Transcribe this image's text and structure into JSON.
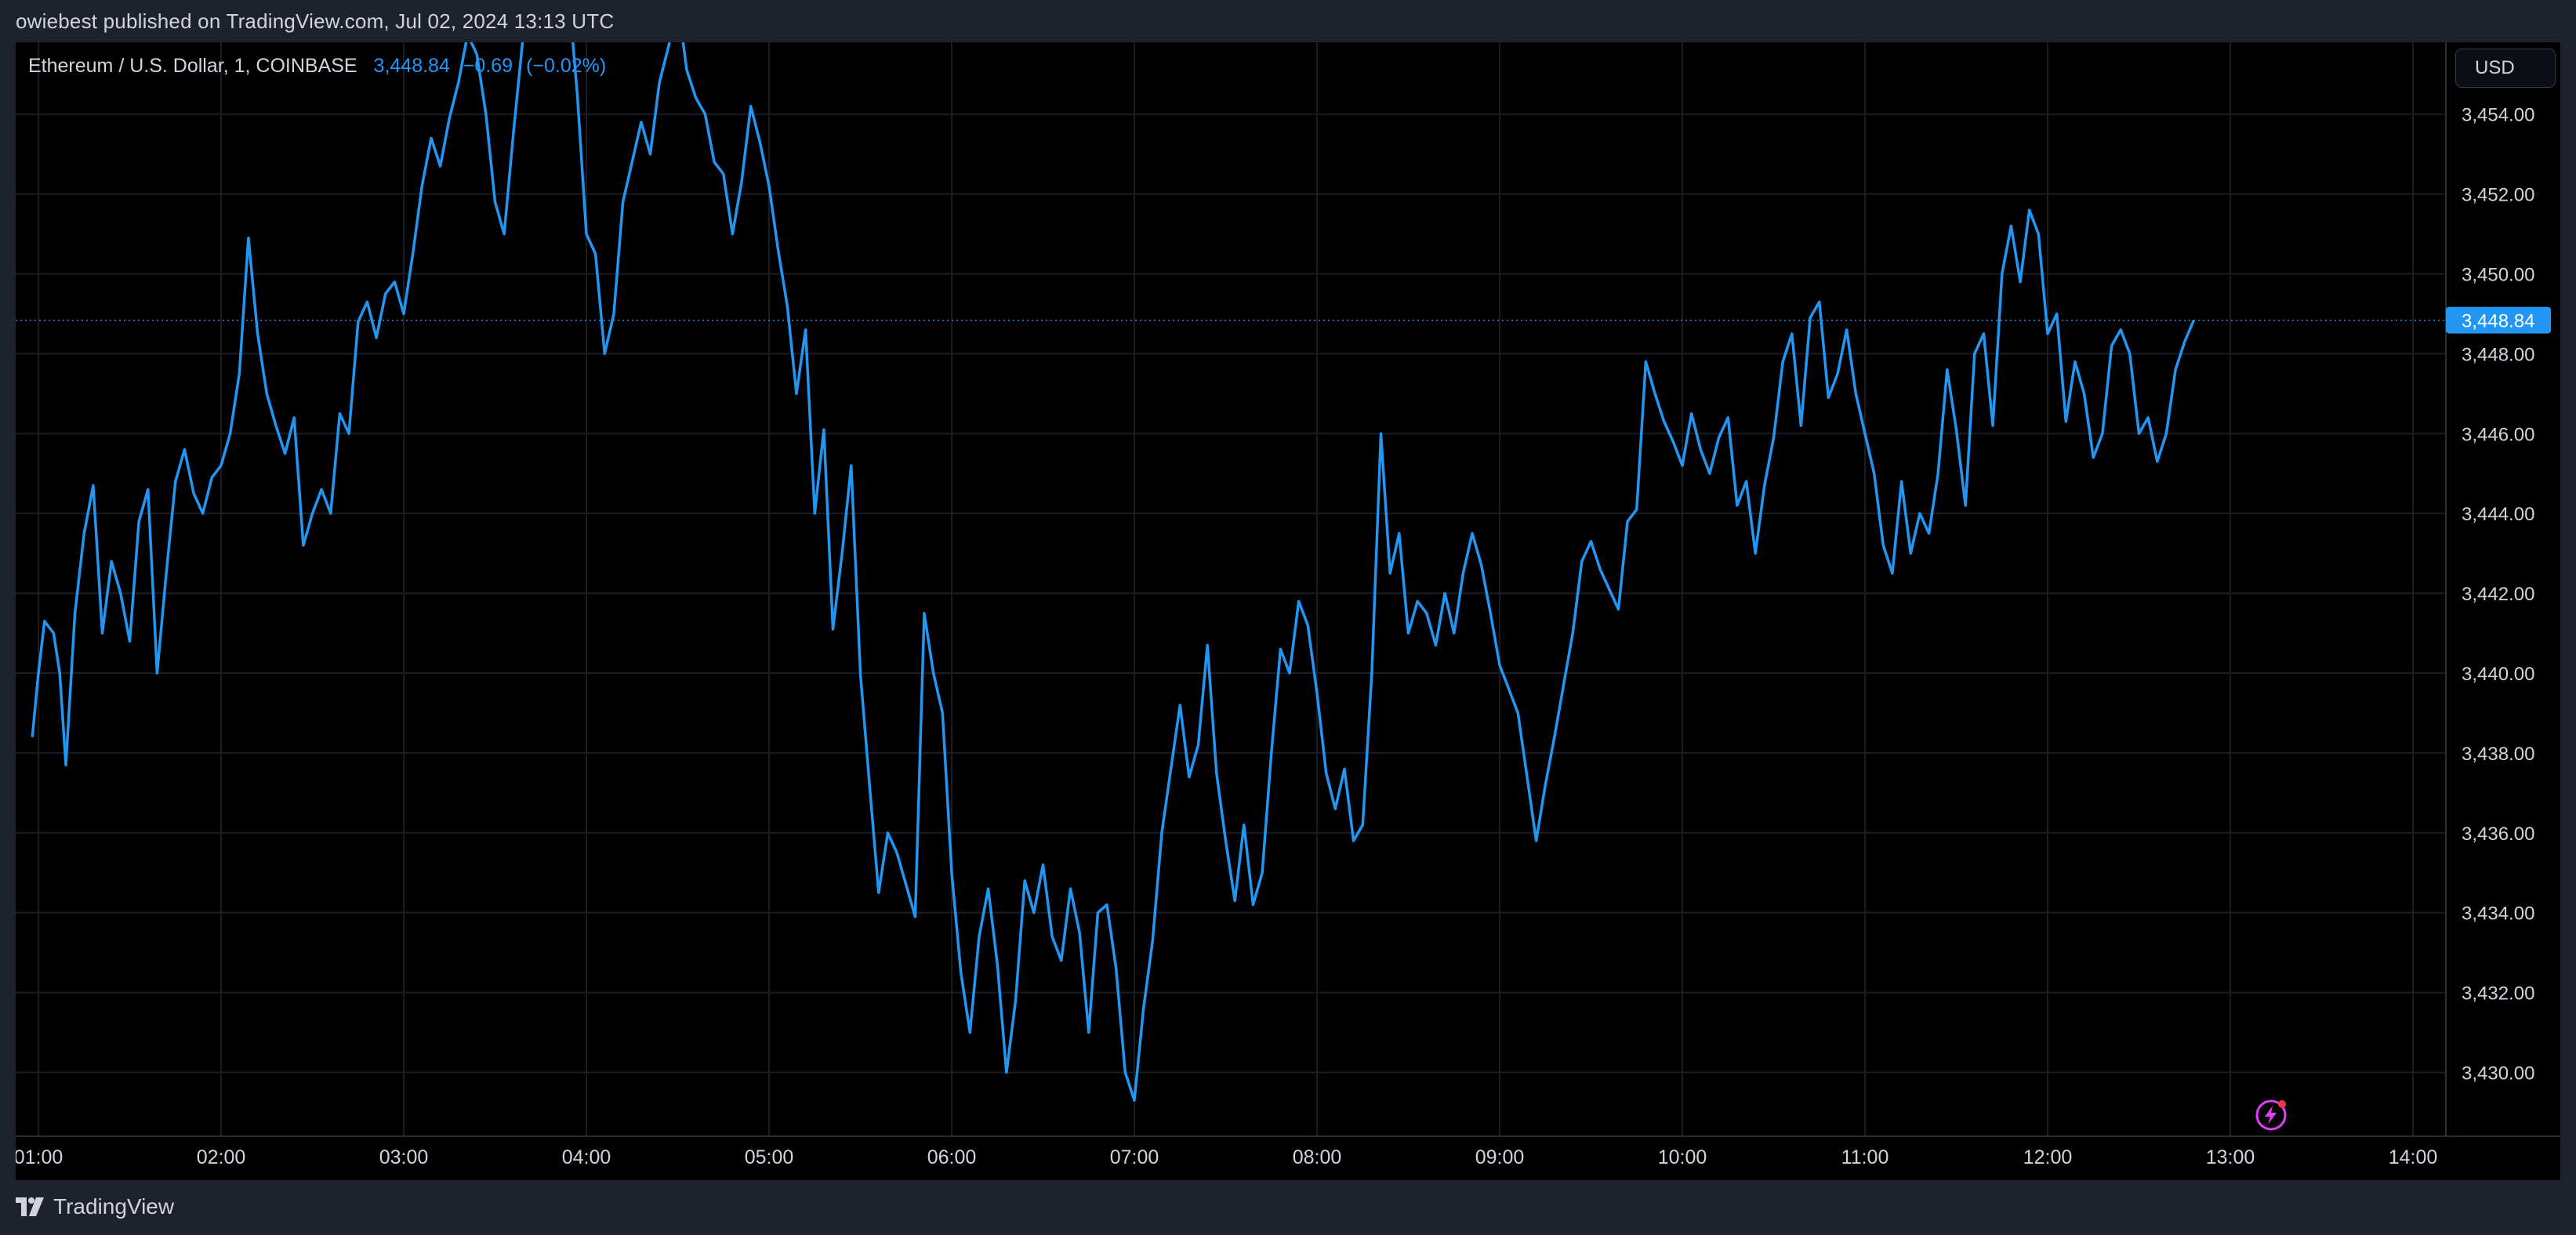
{
  "header": {
    "publish_text": "owiebest published on TradingView.com, Jul 02, 2024 13:13 UTC"
  },
  "legend": {
    "symbol": "Ethereum / U.S. Dollar, 1, COINBASE",
    "last": "3,448.84",
    "change": "−0.69",
    "change_pct": "(−0.02%)"
  },
  "currency_button": "USD",
  "footer": {
    "brand": "TradingView"
  },
  "icons": [
    "tradingview-logo-icon",
    "lightning-icon"
  ],
  "colors": {
    "line": "#2196f3",
    "background": "#000000",
    "frame": "#1e222d",
    "text": "#d1d4dc",
    "bolt_accent": "#e040fb",
    "bolt_dot": "#f23645"
  },
  "chart_data": {
    "type": "line",
    "title": "Ethereum / U.S. Dollar, 1, COINBASE",
    "series": [
      {
        "values": [
          [
            "00:58",
            3438.4
          ],
          [
            "01:00",
            3440.0
          ],
          [
            "01:02",
            3441.3
          ],
          [
            "01:05",
            3441.0
          ],
          [
            "01:07",
            3440.0
          ],
          [
            "01:09",
            3437.7
          ],
          [
            "01:12",
            3441.5
          ],
          [
            "01:15",
            3443.5
          ],
          [
            "01:18",
            3444.7
          ],
          [
            "01:21",
            3441.0
          ],
          [
            "01:24",
            3442.8
          ],
          [
            "01:27",
            3442.0
          ],
          [
            "01:30",
            3440.8
          ],
          [
            "01:33",
            3443.8
          ],
          [
            "01:36",
            3444.6
          ],
          [
            "01:39",
            3440.0
          ],
          [
            "01:42",
            3442.5
          ],
          [
            "01:45",
            3444.8
          ],
          [
            "01:48",
            3445.6
          ],
          [
            "01:51",
            3444.5
          ],
          [
            "01:54",
            3444.0
          ],
          [
            "01:57",
            3444.9
          ],
          [
            "02:00",
            3445.2
          ],
          [
            "02:03",
            3446.0
          ],
          [
            "02:06",
            3447.5
          ],
          [
            "02:09",
            3450.9
          ],
          [
            "02:12",
            3448.5
          ],
          [
            "02:15",
            3447.0
          ],
          [
            "02:18",
            3446.2
          ],
          [
            "02:21",
            3445.5
          ],
          [
            "02:24",
            3446.4
          ],
          [
            "02:27",
            3443.2
          ],
          [
            "02:30",
            3444.0
          ],
          [
            "02:33",
            3444.6
          ],
          [
            "02:36",
            3444.0
          ],
          [
            "02:39",
            3446.5
          ],
          [
            "02:42",
            3446.0
          ],
          [
            "02:45",
            3448.8
          ],
          [
            "02:48",
            3449.3
          ],
          [
            "02:51",
            3448.4
          ],
          [
            "02:54",
            3449.5
          ],
          [
            "02:57",
            3449.8
          ],
          [
            "03:00",
            3449.0
          ],
          [
            "03:03",
            3450.5
          ],
          [
            "03:06",
            3452.2
          ],
          [
            "03:09",
            3453.4
          ],
          [
            "03:12",
            3452.7
          ],
          [
            "03:15",
            3453.9
          ],
          [
            "03:18",
            3454.8
          ],
          [
            "03:21",
            3456.0
          ],
          [
            "03:24",
            3455.5
          ],
          [
            "03:27",
            3454.0
          ],
          [
            "03:30",
            3451.8
          ],
          [
            "03:33",
            3451.0
          ],
          [
            "03:36",
            3453.5
          ],
          [
            "03:39",
            3455.8
          ],
          [
            "03:42",
            3456.5
          ],
          [
            "03:45",
            3457.0
          ],
          [
            "03:48",
            3456.0
          ],
          [
            "03:51",
            3456.6
          ],
          [
            "03:54",
            3457.2
          ],
          [
            "03:57",
            3454.5
          ],
          [
            "04:00",
            3451.0
          ],
          [
            "04:03",
            3450.5
          ],
          [
            "04:06",
            3448.0
          ],
          [
            "04:09",
            3449.0
          ],
          [
            "04:12",
            3451.8
          ],
          [
            "04:15",
            3452.8
          ],
          [
            "04:18",
            3453.8
          ],
          [
            "04:21",
            3453.0
          ],
          [
            "04:24",
            3454.8
          ],
          [
            "04:27",
            3455.7
          ],
          [
            "04:30",
            3456.8
          ],
          [
            "04:33",
            3455.1
          ],
          [
            "04:36",
            3454.4
          ],
          [
            "04:39",
            3454.0
          ],
          [
            "04:42",
            3452.8
          ],
          [
            "04:45",
            3452.5
          ],
          [
            "04:48",
            3451.0
          ],
          [
            "04:51",
            3452.3
          ],
          [
            "04:54",
            3454.2
          ],
          [
            "04:57",
            3453.3
          ],
          [
            "05:00",
            3452.2
          ],
          [
            "05:03",
            3450.6
          ],
          [
            "05:06",
            3449.2
          ],
          [
            "05:09",
            3447.0
          ],
          [
            "05:12",
            3448.6
          ],
          [
            "05:15",
            3444.0
          ],
          [
            "05:18",
            3446.1
          ],
          [
            "05:21",
            3441.1
          ],
          [
            "05:24",
            3443.0
          ],
          [
            "05:27",
            3445.2
          ],
          [
            "05:30",
            3440.0
          ],
          [
            "05:33",
            3437.2
          ],
          [
            "05:36",
            3434.5
          ],
          [
            "05:39",
            3436.0
          ],
          [
            "05:42",
            3435.5
          ],
          [
            "05:45",
            3434.7
          ],
          [
            "05:48",
            3433.9
          ],
          [
            "05:51",
            3441.5
          ],
          [
            "05:54",
            3440.0
          ],
          [
            "05:57",
            3439.0
          ],
          [
            "06:00",
            3435.0
          ],
          [
            "06:03",
            3432.5
          ],
          [
            "06:06",
            3431.0
          ],
          [
            "06:09",
            3433.4
          ],
          [
            "06:12",
            3434.6
          ],
          [
            "06:15",
            3432.7
          ],
          [
            "06:18",
            3430.0
          ],
          [
            "06:21",
            3431.8
          ],
          [
            "06:24",
            3434.8
          ],
          [
            "06:27",
            3434.0
          ],
          [
            "06:30",
            3435.2
          ],
          [
            "06:33",
            3433.4
          ],
          [
            "06:36",
            3432.8
          ],
          [
            "06:39",
            3434.6
          ],
          [
            "06:42",
            3433.5
          ],
          [
            "06:45",
            3431.0
          ],
          [
            "06:48",
            3434.0
          ],
          [
            "06:51",
            3434.2
          ],
          [
            "06:54",
            3432.6
          ],
          [
            "06:57",
            3430.0
          ],
          [
            "07:00",
            3429.3
          ],
          [
            "07:03",
            3431.6
          ],
          [
            "07:06",
            3433.3
          ],
          [
            "07:09",
            3436.0
          ],
          [
            "07:12",
            3437.6
          ],
          [
            "07:15",
            3439.2
          ],
          [
            "07:18",
            3437.4
          ],
          [
            "07:21",
            3438.2
          ],
          [
            "07:24",
            3440.7
          ],
          [
            "07:27",
            3437.5
          ],
          [
            "07:30",
            3435.8
          ],
          [
            "07:33",
            3434.3
          ],
          [
            "07:36",
            3436.2
          ],
          [
            "07:39",
            3434.2
          ],
          [
            "07:42",
            3435.0
          ],
          [
            "07:45",
            3438.0
          ],
          [
            "07:48",
            3440.6
          ],
          [
            "07:51",
            3440.0
          ],
          [
            "07:54",
            3441.8
          ],
          [
            "07:57",
            3441.2
          ],
          [
            "08:00",
            3439.5
          ],
          [
            "08:03",
            3437.5
          ],
          [
            "08:06",
            3436.6
          ],
          [
            "08:09",
            3437.6
          ],
          [
            "08:12",
            3435.8
          ],
          [
            "08:15",
            3436.2
          ],
          [
            "08:18",
            3440.0
          ],
          [
            "08:21",
            3446.0
          ],
          [
            "08:24",
            3442.5
          ],
          [
            "08:27",
            3443.5
          ],
          [
            "08:30",
            3441.0
          ],
          [
            "08:33",
            3441.8
          ],
          [
            "08:36",
            3441.5
          ],
          [
            "08:39",
            3440.7
          ],
          [
            "08:42",
            3442.0
          ],
          [
            "08:45",
            3441.0
          ],
          [
            "08:48",
            3442.5
          ],
          [
            "08:51",
            3443.5
          ],
          [
            "08:54",
            3442.7
          ],
          [
            "08:57",
            3441.5
          ],
          [
            "09:00",
            3440.2
          ],
          [
            "09:03",
            3439.6
          ],
          [
            "09:06",
            3439.0
          ],
          [
            "09:09",
            3437.4
          ],
          [
            "09:12",
            3435.8
          ],
          [
            "09:15",
            3437.2
          ],
          [
            "09:18",
            3438.4
          ],
          [
            "09:21",
            3439.7
          ],
          [
            "09:24",
            3441.0
          ],
          [
            "09:27",
            3442.8
          ],
          [
            "09:30",
            3443.3
          ],
          [
            "09:33",
            3442.6
          ],
          [
            "09:36",
            3442.1
          ],
          [
            "09:39",
            3441.6
          ],
          [
            "09:42",
            3443.8
          ],
          [
            "09:45",
            3444.1
          ],
          [
            "09:48",
            3447.8
          ],
          [
            "09:51",
            3447.0
          ],
          [
            "09:54",
            3446.3
          ],
          [
            "09:57",
            3445.8
          ],
          [
            "10:00",
            3445.2
          ],
          [
            "10:03",
            3446.5
          ],
          [
            "10:06",
            3445.6
          ],
          [
            "10:09",
            3445.0
          ],
          [
            "10:12",
            3445.9
          ],
          [
            "10:15",
            3446.4
          ],
          [
            "10:18",
            3444.2
          ],
          [
            "10:21",
            3444.8
          ],
          [
            "10:24",
            3443.0
          ],
          [
            "10:27",
            3444.7
          ],
          [
            "10:30",
            3445.9
          ],
          [
            "10:33",
            3447.8
          ],
          [
            "10:36",
            3448.5
          ],
          [
            "10:39",
            3446.2
          ],
          [
            "10:42",
            3448.9
          ],
          [
            "10:45",
            3449.3
          ],
          [
            "10:48",
            3446.9
          ],
          [
            "10:51",
            3447.5
          ],
          [
            "10:54",
            3448.6
          ],
          [
            "10:57",
            3447.0
          ],
          [
            "11:00",
            3446.0
          ],
          [
            "11:03",
            3445.0
          ],
          [
            "11:06",
            3443.2
          ],
          [
            "11:09",
            3442.5
          ],
          [
            "11:12",
            3444.8
          ],
          [
            "11:15",
            3443.0
          ],
          [
            "11:18",
            3444.0
          ],
          [
            "11:21",
            3443.5
          ],
          [
            "11:24",
            3445.0
          ],
          [
            "11:27",
            3447.6
          ],
          [
            "11:30",
            3446.1
          ],
          [
            "11:33",
            3444.2
          ],
          [
            "11:36",
            3448.0
          ],
          [
            "11:39",
            3448.5
          ],
          [
            "11:42",
            3446.2
          ],
          [
            "11:45",
            3450.0
          ],
          [
            "11:48",
            3451.2
          ],
          [
            "11:51",
            3449.8
          ],
          [
            "11:54",
            3451.6
          ],
          [
            "11:57",
            3451.0
          ],
          [
            "12:00",
            3448.5
          ],
          [
            "12:03",
            3449.0
          ],
          [
            "12:06",
            3446.3
          ],
          [
            "12:09",
            3447.8
          ],
          [
            "12:12",
            3447.0
          ],
          [
            "12:15",
            3445.4
          ],
          [
            "12:18",
            3446.0
          ],
          [
            "12:21",
            3448.2
          ],
          [
            "12:24",
            3448.6
          ],
          [
            "12:27",
            3448.0
          ],
          [
            "12:30",
            3446.0
          ],
          [
            "12:33",
            3446.4
          ],
          [
            "12:36",
            3445.3
          ],
          [
            "12:39",
            3446.0
          ],
          [
            "12:42",
            3447.6
          ],
          [
            "12:45",
            3448.3
          ],
          [
            "12:48",
            3448.84
          ]
        ]
      }
    ],
    "x_ticks": [
      "01:00",
      "02:00",
      "03:00",
      "04:00",
      "05:00",
      "06:00",
      "07:00",
      "08:00",
      "09:00",
      "10:00",
      "11:00",
      "12:00",
      "13:00",
      "14:00"
    ],
    "y_ticks": [
      "3,430.00",
      "3,432.00",
      "3,434.00",
      "3,436.00",
      "3,438.00",
      "3,440.00",
      "3,442.00",
      "3,444.00",
      "3,446.00",
      "3,448.00",
      "3,450.00",
      "3,452.00",
      "3,454.00"
    ],
    "ylim": [
      3428.4,
      3455.8
    ],
    "last_price_label": "3,448.84",
    "grid": true
  }
}
